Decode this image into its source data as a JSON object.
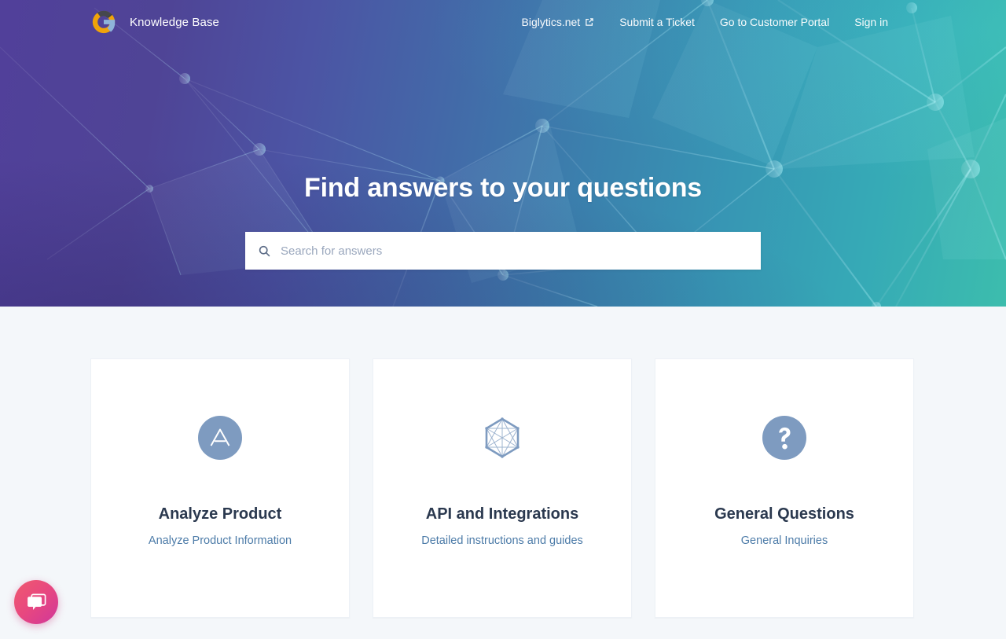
{
  "brand": {
    "name": "Knowledge Base",
    "logo_icon": "google-g-logo-icon"
  },
  "nav": {
    "links": [
      {
        "label": "Biglytics.net",
        "icon": "external-link-icon",
        "external": true
      },
      {
        "label": "Submit a Ticket",
        "external": false
      },
      {
        "label": "Go to Customer Portal",
        "external": false
      },
      {
        "label": "Sign in",
        "external": false
      }
    ]
  },
  "hero": {
    "title": "Find answers to your questions",
    "gradient_from": "#51409a",
    "gradient_mid": "#3b80ad",
    "gradient_to": "#3cbdad"
  },
  "search": {
    "placeholder": "Search for answers",
    "value": "",
    "icon": "search-icon"
  },
  "cards": [
    {
      "icon": "triangle-a-circle-icon",
      "title": "Analyze Product",
      "subtitle": "Analyze Product Information"
    },
    {
      "icon": "hexagon-network-icon",
      "title": "API and Integrations",
      "subtitle": "Detailed instructions and guides"
    },
    {
      "icon": "question-mark-circle-icon",
      "title": "General Questions",
      "subtitle": "General Inquiries"
    }
  ],
  "chat": {
    "icon": "chat-bubbles-icon",
    "label": "Open chat"
  },
  "colors": {
    "page_background": "#f4f7fa",
    "card_background": "#ffffff",
    "card_title": "#2b394f",
    "card_subtitle": "#4c7ba8",
    "card_icon": "#7e9bc0",
    "chat_accent": "#e8487f"
  }
}
